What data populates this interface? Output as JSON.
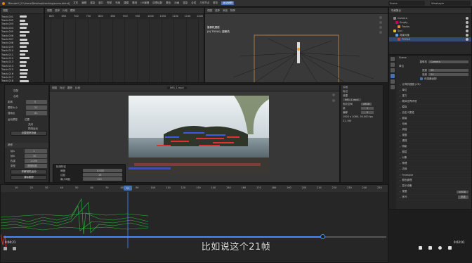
{
  "topbar": {
    "title": "Blender* [C:\\Users\\Desktop\\tracking\\scene.blend]",
    "menus": [
      "文件",
      "编辑",
      "渲染",
      "窗口",
      "帮助"
    ],
    "workspace_tabs": [
      "布局",
      "建模",
      "雕刻",
      "UV编辑",
      "纹理绘制",
      "着色",
      "动画",
      "渲染",
      "合成",
      "几何节点",
      "脚本",
      "运动追踪"
    ],
    "scene_label": "Scene",
    "view_layer_label": "ViewLayer"
  },
  "tracks": {
    "labels": [
      "Track.001",
      "Track.002",
      "Track.003",
      "Track.004",
      "Track.005",
      "Track.006",
      "Track.007",
      "Track.008",
      "Track.009",
      "Track.010",
      "Track.011",
      "Track.012",
      "Track.013",
      "Track.014",
      "Track.015",
      "Track.016",
      "Track.017",
      "Track.018"
    ],
    "header": [
      "视图",
      "选择",
      "片段",
      "跟踪"
    ]
  },
  "viewport": {
    "header": [
      "视图",
      "选择",
      "添加",
      "物体"
    ],
    "info_line1": "摄像机透视",
    "info_line2": "(0) TOOLS | 摄像机"
  },
  "outliner": {
    "title": "场景集合",
    "items": [
      "Camera",
      "Empty",
      "Tracks",
      "Sun",
      "背景对象",
      "TOOLS"
    ]
  },
  "properties": {
    "scene_label": "Scene",
    "camera_label": "摄像机",
    "camera_value": "Camera",
    "units_label": "单位",
    "width_label": "宽度",
    "width_value": "36",
    "height_label": "高度",
    "height_value": "24",
    "sensor_fit": "传感器适配",
    "sections": [
      "计算机视图 (VR)",
      "单位",
      "重力",
      "刚体世界环境",
      "模拟",
      "自定义属性",
      "链接",
      "动画",
      "烘焙",
      "视图",
      "透视",
      "阴影",
      "图层",
      "对象",
      "物理",
      "边缘",
      "Freestyle",
      "颜色管理",
      "显示设备",
      "视图",
      "序列"
    ],
    "display_device_value": "sRGB",
    "view_value": "标准"
  },
  "clip_tools": {
    "header": [
      "视图",
      "标记",
      "跟踪",
      "重建"
    ],
    "labels": [
      "匹配",
      "合成",
      "帧",
      "跟踪",
      "运动模型",
      "位置",
      "关闭",
      "预测运动",
      "归一化",
      "遮罩"
    ],
    "fields": [
      {
        "label": "距离",
        "value": "0"
      },
      {
        "label": "跟踪大小",
        "value": "21"
      },
      {
        "label": "搜索区",
        "value": "61"
      }
    ],
    "buttons": [
      "清除跟踪",
      "设置跟踪",
      "平面跟踪"
    ],
    "refine_header": "精修",
    "refine_fields": [
      {
        "label": "帧A",
        "value": "1"
      },
      {
        "label": "帧B",
        "value": "30"
      },
      {
        "label": "权重",
        "value": "1.000"
      },
      {
        "label": "类型",
        "value": "透视相机"
      }
    ],
    "solve_button": "求解相机运动",
    "setup_button": "设置跟踪场景"
  },
  "clip_editor": {
    "header": [
      "视图",
      "标记",
      "跟踪",
      "片段"
    ],
    "clip_name": "IMG_1.mp4",
    "popup": {
      "title": "检测特征",
      "rows": [
        {
          "label": "阈值",
          "value": "0.005"
        },
        {
          "label": "边距",
          "value": "16"
        },
        {
          "label": "最小间距",
          "value": "120"
        },
        {
          "label": "位置",
          "value": "整帧"
        }
      ]
    }
  },
  "clip_sidebar": {
    "sections": [
      "片段",
      "标记",
      "设置"
    ],
    "clip_name": "IMG_1.mp4",
    "fields": [
      {
        "label": "色彩空间",
        "value": "sRGB"
      },
      {
        "label": "帧",
        "value": "1"
      },
      {
        "label": "偏移",
        "value": "0"
      },
      {
        "label": "视频",
        "value": "1920 x 1080, 30.000 fps"
      },
      {
        "label": "帧",
        "value": "21 / 60"
      }
    ]
  },
  "timeline": {
    "ticks": [
      "10",
      "20",
      "30",
      "40",
      "50",
      "60",
      "70",
      "80",
      "90",
      "100",
      "110",
      "120",
      "130",
      "140",
      "150",
      "160",
      "170",
      "180",
      "190",
      "200",
      "210",
      "220",
      "230",
      "240",
      "250"
    ],
    "current_frame": "21",
    "time_start": "0:00:21",
    "time_end": "0:02:01"
  },
  "subtitle": "比如说这个21帧",
  "colors": {
    "accent": "#3d6dc4",
    "playhead": "#4a8cff",
    "curve_green": "#2ecc40",
    "curve_red": "#e53935",
    "marker_orange": "#e09030"
  },
  "player": {
    "controls": [
      "play-icon",
      "volume-icon",
      "subtitle-icon",
      "settings-icon",
      "fullscreen-icon",
      "pencil-icon"
    ]
  }
}
